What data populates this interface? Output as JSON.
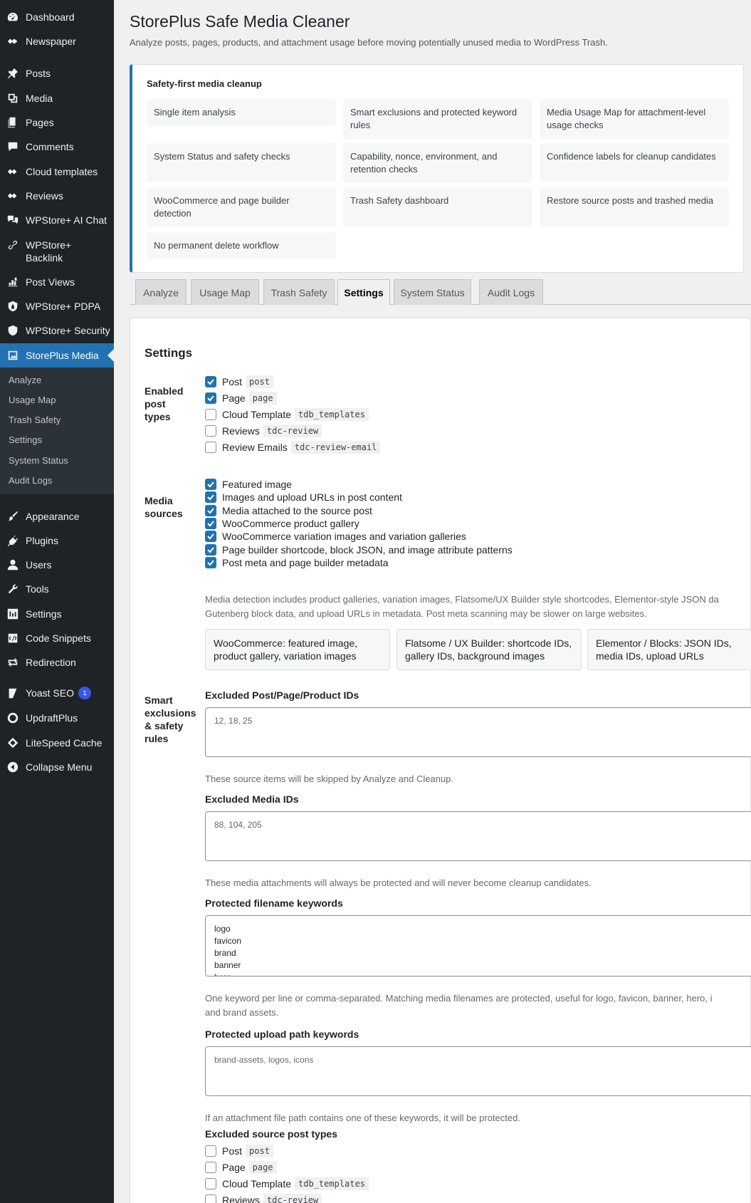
{
  "sidebar": {
    "items": [
      {
        "label": "Dashboard",
        "icon": "dashboard-icon"
      },
      {
        "label": "Newspaper",
        "icon": "newspaper-icon"
      },
      {
        "label": "Posts",
        "icon": "pin-icon"
      },
      {
        "label": "Media",
        "icon": "media-icon"
      },
      {
        "label": "Pages",
        "icon": "pages-icon"
      },
      {
        "label": "Comments",
        "icon": "comment-icon"
      },
      {
        "label": "Cloud templates",
        "icon": "diamond-icon"
      },
      {
        "label": "Reviews",
        "icon": "diamond-icon"
      },
      {
        "label": "WPStore+ AI Chat",
        "icon": "chat-icon"
      },
      {
        "label": "WPStore+ Backlink",
        "icon": "link-icon"
      },
      {
        "label": "Post Views",
        "icon": "chart-icon"
      },
      {
        "label": "WPStore+ PDPA",
        "icon": "lock-icon"
      },
      {
        "label": "WPStore+ Security",
        "icon": "shield-icon"
      },
      {
        "label": "StorePlus Media",
        "icon": "image-icon"
      },
      {
        "label": "Appearance",
        "icon": "brush-icon"
      },
      {
        "label": "Plugins",
        "icon": "plugin-icon"
      },
      {
        "label": "Users",
        "icon": "user-icon"
      },
      {
        "label": "Tools",
        "icon": "wrench-icon"
      },
      {
        "label": "Settings",
        "icon": "settings-icon"
      },
      {
        "label": "Code Snippets",
        "icon": "code-icon"
      },
      {
        "label": "Redirection",
        "icon": "redirect-icon"
      },
      {
        "label": "Yoast SEO",
        "icon": "yoast-icon",
        "badge": "1"
      },
      {
        "label": "UpdraftPlus",
        "icon": "updraft-icon"
      },
      {
        "label": "LiteSpeed Cache",
        "icon": "diamond-icon"
      },
      {
        "label": "Collapse Menu",
        "icon": "collapse-icon"
      }
    ],
    "submenu": [
      "Analyze",
      "Usage Map",
      "Trash Safety",
      "Settings",
      "System Status",
      "Audit Logs"
    ]
  },
  "header": {
    "title": "StorePlus Safe Media Cleaner",
    "description": "Analyze posts, pages, products, and attachment usage before moving potentially unused media to WordPress Trash."
  },
  "notice": {
    "title": "Safety-first media cleanup",
    "features": [
      "Single item analysis",
      "Smart exclusions and protected keyword rules",
      "Media Usage Map for attachment-level usage checks",
      "System Status and safety checks",
      "Capability, nonce, environment, and retention checks",
      "Confidence labels for cleanup candidates",
      "WooCommerce and page builder detection",
      "Trash Safety dashboard",
      "Restore source posts and trashed media",
      "No permanent delete workflow"
    ]
  },
  "tabs": [
    "Analyze",
    "Usage Map",
    "Trash Safety",
    "Settings",
    "System Status",
    "Audit Logs"
  ],
  "settings": {
    "heading": "Settings",
    "post_types_label": "Enabled post types",
    "post_types": [
      {
        "label": "Post",
        "slug": "post",
        "checked": true
      },
      {
        "label": "Page",
        "slug": "page",
        "checked": true
      },
      {
        "label": "Cloud Template",
        "slug": "tdb_templates",
        "checked": false
      },
      {
        "label": "Reviews",
        "slug": "tdc-review",
        "checked": false
      },
      {
        "label": "Review Emails",
        "slug": "tdc-review-email",
        "checked": false
      }
    ],
    "media_sources_label": "Media sources",
    "media_sources": [
      {
        "label": "Featured image",
        "checked": true
      },
      {
        "label": "Images and upload URLs in post content",
        "checked": true
      },
      {
        "label": "Media attached to the source post",
        "checked": true
      },
      {
        "label": "WooCommerce product gallery",
        "checked": true
      },
      {
        "label": "WooCommerce variation images and variation galleries",
        "checked": true
      },
      {
        "label": "Page builder shortcode, block JSON, and image attribute patterns",
        "checked": true
      },
      {
        "label": "Post meta and page builder metadata",
        "checked": true
      }
    ],
    "media_help_1": "Media detection includes product galleries, variation images, Flatsome/UX Builder style shortcodes, Elementor-style JSON da",
    "media_help_2": "Gutenberg block data, and upload URLs in metadata. Post meta scanning may be slower on large websites.",
    "source_cards": [
      "WooCommerce: featured image, product gallery, variation images",
      "Flatsome / UX Builder: shortcode IDs, gallery IDs, background images",
      "Elementor / Blocks: JSON IDs, media IDs, upload URLs"
    ],
    "exclusions_label": "Smart exclusions & safety rules",
    "excluded_ids_label": "Excluded Post/Page/Product IDs",
    "excluded_ids_placeholder": "12, 18, 25",
    "excluded_ids_help": "These source items will be skipped by Analyze and Cleanup.",
    "excluded_media_label": "Excluded Media IDs",
    "excluded_media_placeholder": "88, 104, 205",
    "excluded_media_help": "These media attachments will always be protected and will never become cleanup candidates.",
    "protected_keywords_label": "Protected filename keywords",
    "protected_keywords": [
      "logo",
      "favicon",
      "brand",
      "banner",
      "hero"
    ],
    "protected_keywords_help_1": "One keyword per line or comma-separated. Matching media filenames are protected, useful for logo, favicon, banner, hero, i",
    "protected_keywords_help_2": "and brand assets.",
    "protected_paths_label": "Protected upload path keywords",
    "protected_paths_placeholder": "brand-assets, logos, icons",
    "protected_paths_help": "If an attachment file path contains one of these keywords, it will be protected.",
    "excluded_source_label": "Excluded source post types",
    "excluded_source_types": [
      {
        "label": "Post",
        "slug": "post",
        "checked": false
      },
      {
        "label": "Page",
        "slug": "page",
        "checked": false
      },
      {
        "label": "Cloud Template",
        "slug": "tdb_templates",
        "checked": false
      },
      {
        "label": "Reviews",
        "slug": "tdc-review",
        "checked": false
      }
    ]
  }
}
